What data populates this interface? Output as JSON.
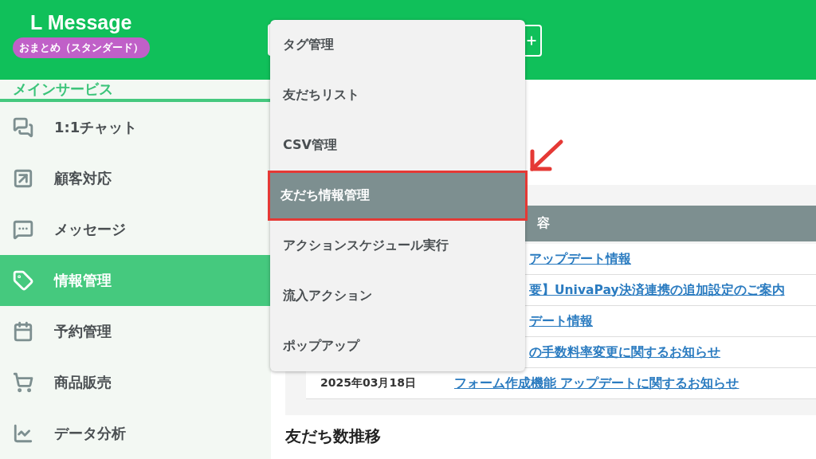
{
  "brand": {
    "name": "L Message",
    "plan": "おまとめ（スタンダード）"
  },
  "sidebar": {
    "section": "メインサービス",
    "items": [
      {
        "label": "1:1チャット",
        "selected": false
      },
      {
        "label": "顧客対応",
        "selected": false
      },
      {
        "label": "メッセージ",
        "selected": false
      },
      {
        "label": "情報管理",
        "selected": true
      },
      {
        "label": "予約管理",
        "selected": false
      },
      {
        "label": "商品販売",
        "selected": false
      },
      {
        "label": "データ分析",
        "selected": false
      }
    ]
  },
  "news": {
    "column_2": "容",
    "rows": [
      {
        "date": "",
        "title": "アップデート情報"
      },
      {
        "date": "",
        "title": "要】UnivaPay決済連携の追加設定のご案内"
      },
      {
        "date": "",
        "title": "デート情報"
      },
      {
        "date": "",
        "title": "の手数料率変更に関するお知らせ"
      },
      {
        "date": "2025年03月18日",
        "title": "フォーム作成機能 アップデートに関するお知らせ"
      }
    ]
  },
  "section_heading": "友だち数推移",
  "dropdown": {
    "items": [
      {
        "label": "タグ管理",
        "selected": false
      },
      {
        "label": "友だちリスト",
        "selected": false
      },
      {
        "label": "CSV管理",
        "selected": false
      },
      {
        "label": "友だち情報管理",
        "selected": true
      },
      {
        "label": "アクションスケジュール実行",
        "selected": false
      },
      {
        "label": "流入アクション",
        "selected": false
      },
      {
        "label": "ポップアップ",
        "selected": false
      }
    ]
  }
}
